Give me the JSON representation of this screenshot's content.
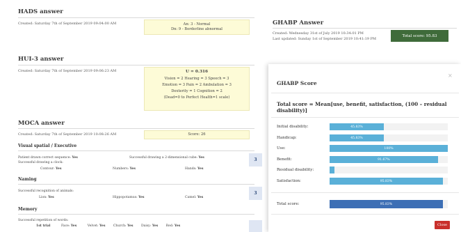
{
  "hads": {
    "title": "HADS answer",
    "created": "Created: Saturday 7th of September 2019 09:04:00 AM",
    "result_line1": "An: 3 - Normal",
    "result_line2": "Dn: 9 - Borderline abnormal"
  },
  "ghabp": {
    "title": "GHABP Answer",
    "created": "Created: Wednesday 31st of July 2019 10:34:01 PM",
    "updated": "Last updated: Sunday 1st of September 2019 10:41:19 PM",
    "total_button": "Total score: 95.83"
  },
  "hui3": {
    "title": "HUI-3 answer",
    "created": "Created: Saturday 7th of September 2019 09:06:23 AM",
    "u_value": "U = 0.316",
    "line1": "Vision = 2 Hearing = 3 Speech = 3",
    "line2": "Emotion = 3 Pain = 2 Ambulation = 3",
    "line3": "Dexterity = 1 Cognition = 2",
    "line4": "(Dead=0 to Perfect Health=1 scale)"
  },
  "moca": {
    "title": "MOCA answer",
    "created": "Created: Saturday 7th of September 2019 10:08:26 AM",
    "score": "Score: 26",
    "visual_title": "Visual spatial / Executive",
    "visual_l1a": "Patient drawn correct sequence:",
    "visual_l1a_v": "Yes",
    "visual_l1b": "Successful drawing a 2-dimensional cube:",
    "visual_l1b_v": "Yes",
    "visual_l2": "Successful drawing a clock:",
    "contour": "Contour:",
    "contour_v": "Yes",
    "numbers": "Numbers:",
    "numbers_v": "Yes",
    "hands": "Hands:",
    "hands_v": "Yes",
    "visual_score": "3",
    "naming_title": "Naming",
    "naming_l1": "Successful recognition of animals:",
    "lion": "Lion:",
    "lion_v": "Yes",
    "hippo": "Hippopotamus:",
    "hippo_v": "Yes",
    "camel": "Camel:",
    "camel_v": "Yes",
    "naming_score": "3",
    "memory_title": "Memory",
    "memory_l1": "Successful repetition of words:",
    "first_trial": "1st trial",
    "face": "Face:",
    "face_v": "Yes",
    "velvet": "Velvet:",
    "velvet_v": "Yes",
    "church": "Church:",
    "church_v": "Yes",
    "daisy": "Daisy:",
    "daisy_v": "Yes",
    "red": "Red:",
    "red_v": "Yes"
  },
  "modal": {
    "title": "GHABP Score",
    "close_x": "×",
    "formula": "Total score = Mean[use, benefit, satisfaction, (100 – residual disability)]",
    "rows": [
      {
        "label": "Initial disability:",
        "text": "45.83%",
        "value": 45.83
      },
      {
        "label": "Handicap:",
        "text": "45.83%",
        "value": 45.83
      },
      {
        "label": "Use:",
        "text": "100%",
        "value": 100
      },
      {
        "label": "Benefit:",
        "text": "91.67%",
        "value": 91.67
      },
      {
        "label": "Residual disability:",
        "text": "",
        "value": 4.17
      },
      {
        "label": "Satisfaction:",
        "text": "95.83%",
        "value": 95.83
      }
    ],
    "total_label": "Total score:",
    "total_text": "95.83%",
    "total_value": 95.83,
    "close_button": "Close",
    "bar_color": "#5ab0d8",
    "total_bar_color": "#3d6fb5",
    "close_color": "#c9302c"
  }
}
